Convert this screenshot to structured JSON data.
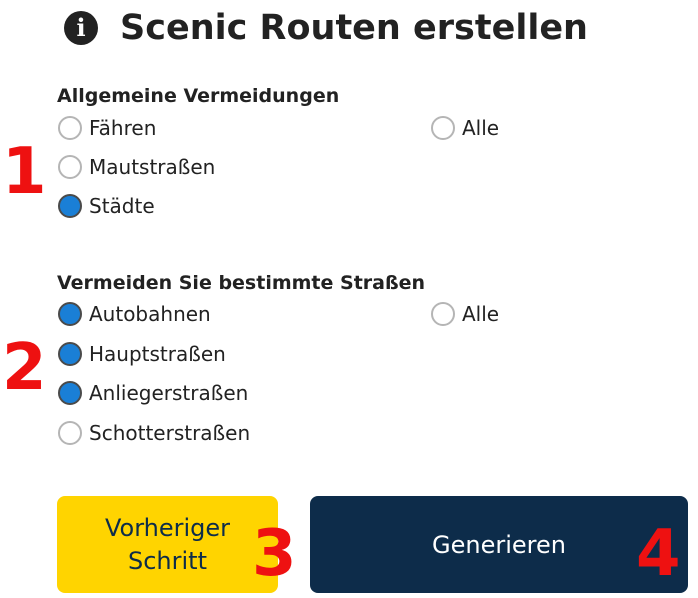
{
  "header": {
    "title": "Scenic Routen erstellen",
    "icon": "info-icon"
  },
  "general_avoidances": {
    "heading": "Allgemeine Vermeidungen",
    "options": [
      {
        "label": "Fähren",
        "checked": false
      },
      {
        "label": "Mautstraßen",
        "checked": false
      },
      {
        "label": "Städte",
        "checked": true
      }
    ],
    "all_label": "Alle",
    "all_checked": false
  },
  "road_avoidances": {
    "heading": "Vermeiden Sie bestimmte Straßen",
    "options": [
      {
        "label": "Autobahnen",
        "checked": true
      },
      {
        "label": "Hauptstraßen",
        "checked": true
      },
      {
        "label": "Anliegerstraßen",
        "checked": true
      },
      {
        "label": "Schotterstraßen",
        "checked": false
      }
    ],
    "all_label": "Alle",
    "all_checked": false
  },
  "buttons": {
    "previous_line1": "Vorheriger",
    "previous_line2": "Schritt",
    "generate": "Generieren"
  },
  "markers": [
    "1",
    "2",
    "3",
    "4"
  ],
  "colors": {
    "primary_dark": "#0d2c4a",
    "accent_yellow": "#ffd400",
    "radio_selected": "#1a7fd6",
    "marker_red": "#ee1111"
  }
}
